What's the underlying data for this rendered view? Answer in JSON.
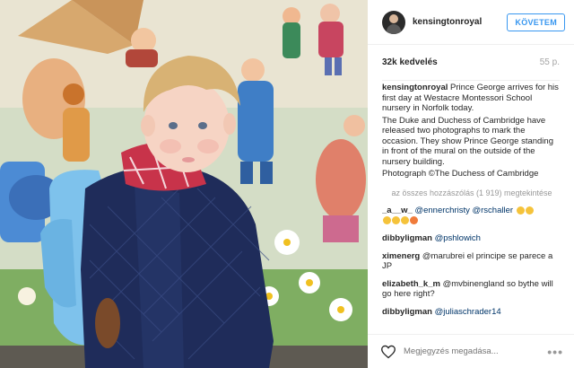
{
  "post": {
    "username": "kensingtonroyal",
    "follow_label": "KÖVETEM",
    "likes": "32k kedvelés",
    "time": "55 p.",
    "caption_user": "kensingtonroyal",
    "caption_p1": "Prince George arrives for his first day at Westacre Montessori School nursery in Norfolk today.",
    "caption_p2": "The Duke and Duchess of Cambridge have released two photographs to mark the occasion. They show Prince George standing in front of the mural on the outside of the nursery building.",
    "caption_p3": "Photograph ©The Duchess of Cambridge",
    "load_more": "az összes hozzászólás (1 919) megtekintése"
  },
  "comments": [
    {
      "user": "_a__w_",
      "text": "@ennerchristy @rschaller",
      "emoji_count": 6
    },
    {
      "user": "dibbyligman",
      "text": "@pshlowich",
      "emoji_count": 0
    },
    {
      "user": "ximenerg",
      "text": "@marubrei el principe se parece a JP",
      "emoji_count": 0
    },
    {
      "user": "elizabeth_k_m",
      "text": "@mvbinengland so bythe will go here right?",
      "emoji_count": 0
    },
    {
      "user": "dibbyligman",
      "text": "@juliaschrader14",
      "emoji_count": 0
    }
  ],
  "footer": {
    "placeholder": "Megjegyzés megadása...",
    "heart_icon": "heart-icon",
    "more_icon": "more-options-icon"
  },
  "colors": {
    "accent": "#3897f0",
    "text": "#262626",
    "muted": "#999999"
  }
}
